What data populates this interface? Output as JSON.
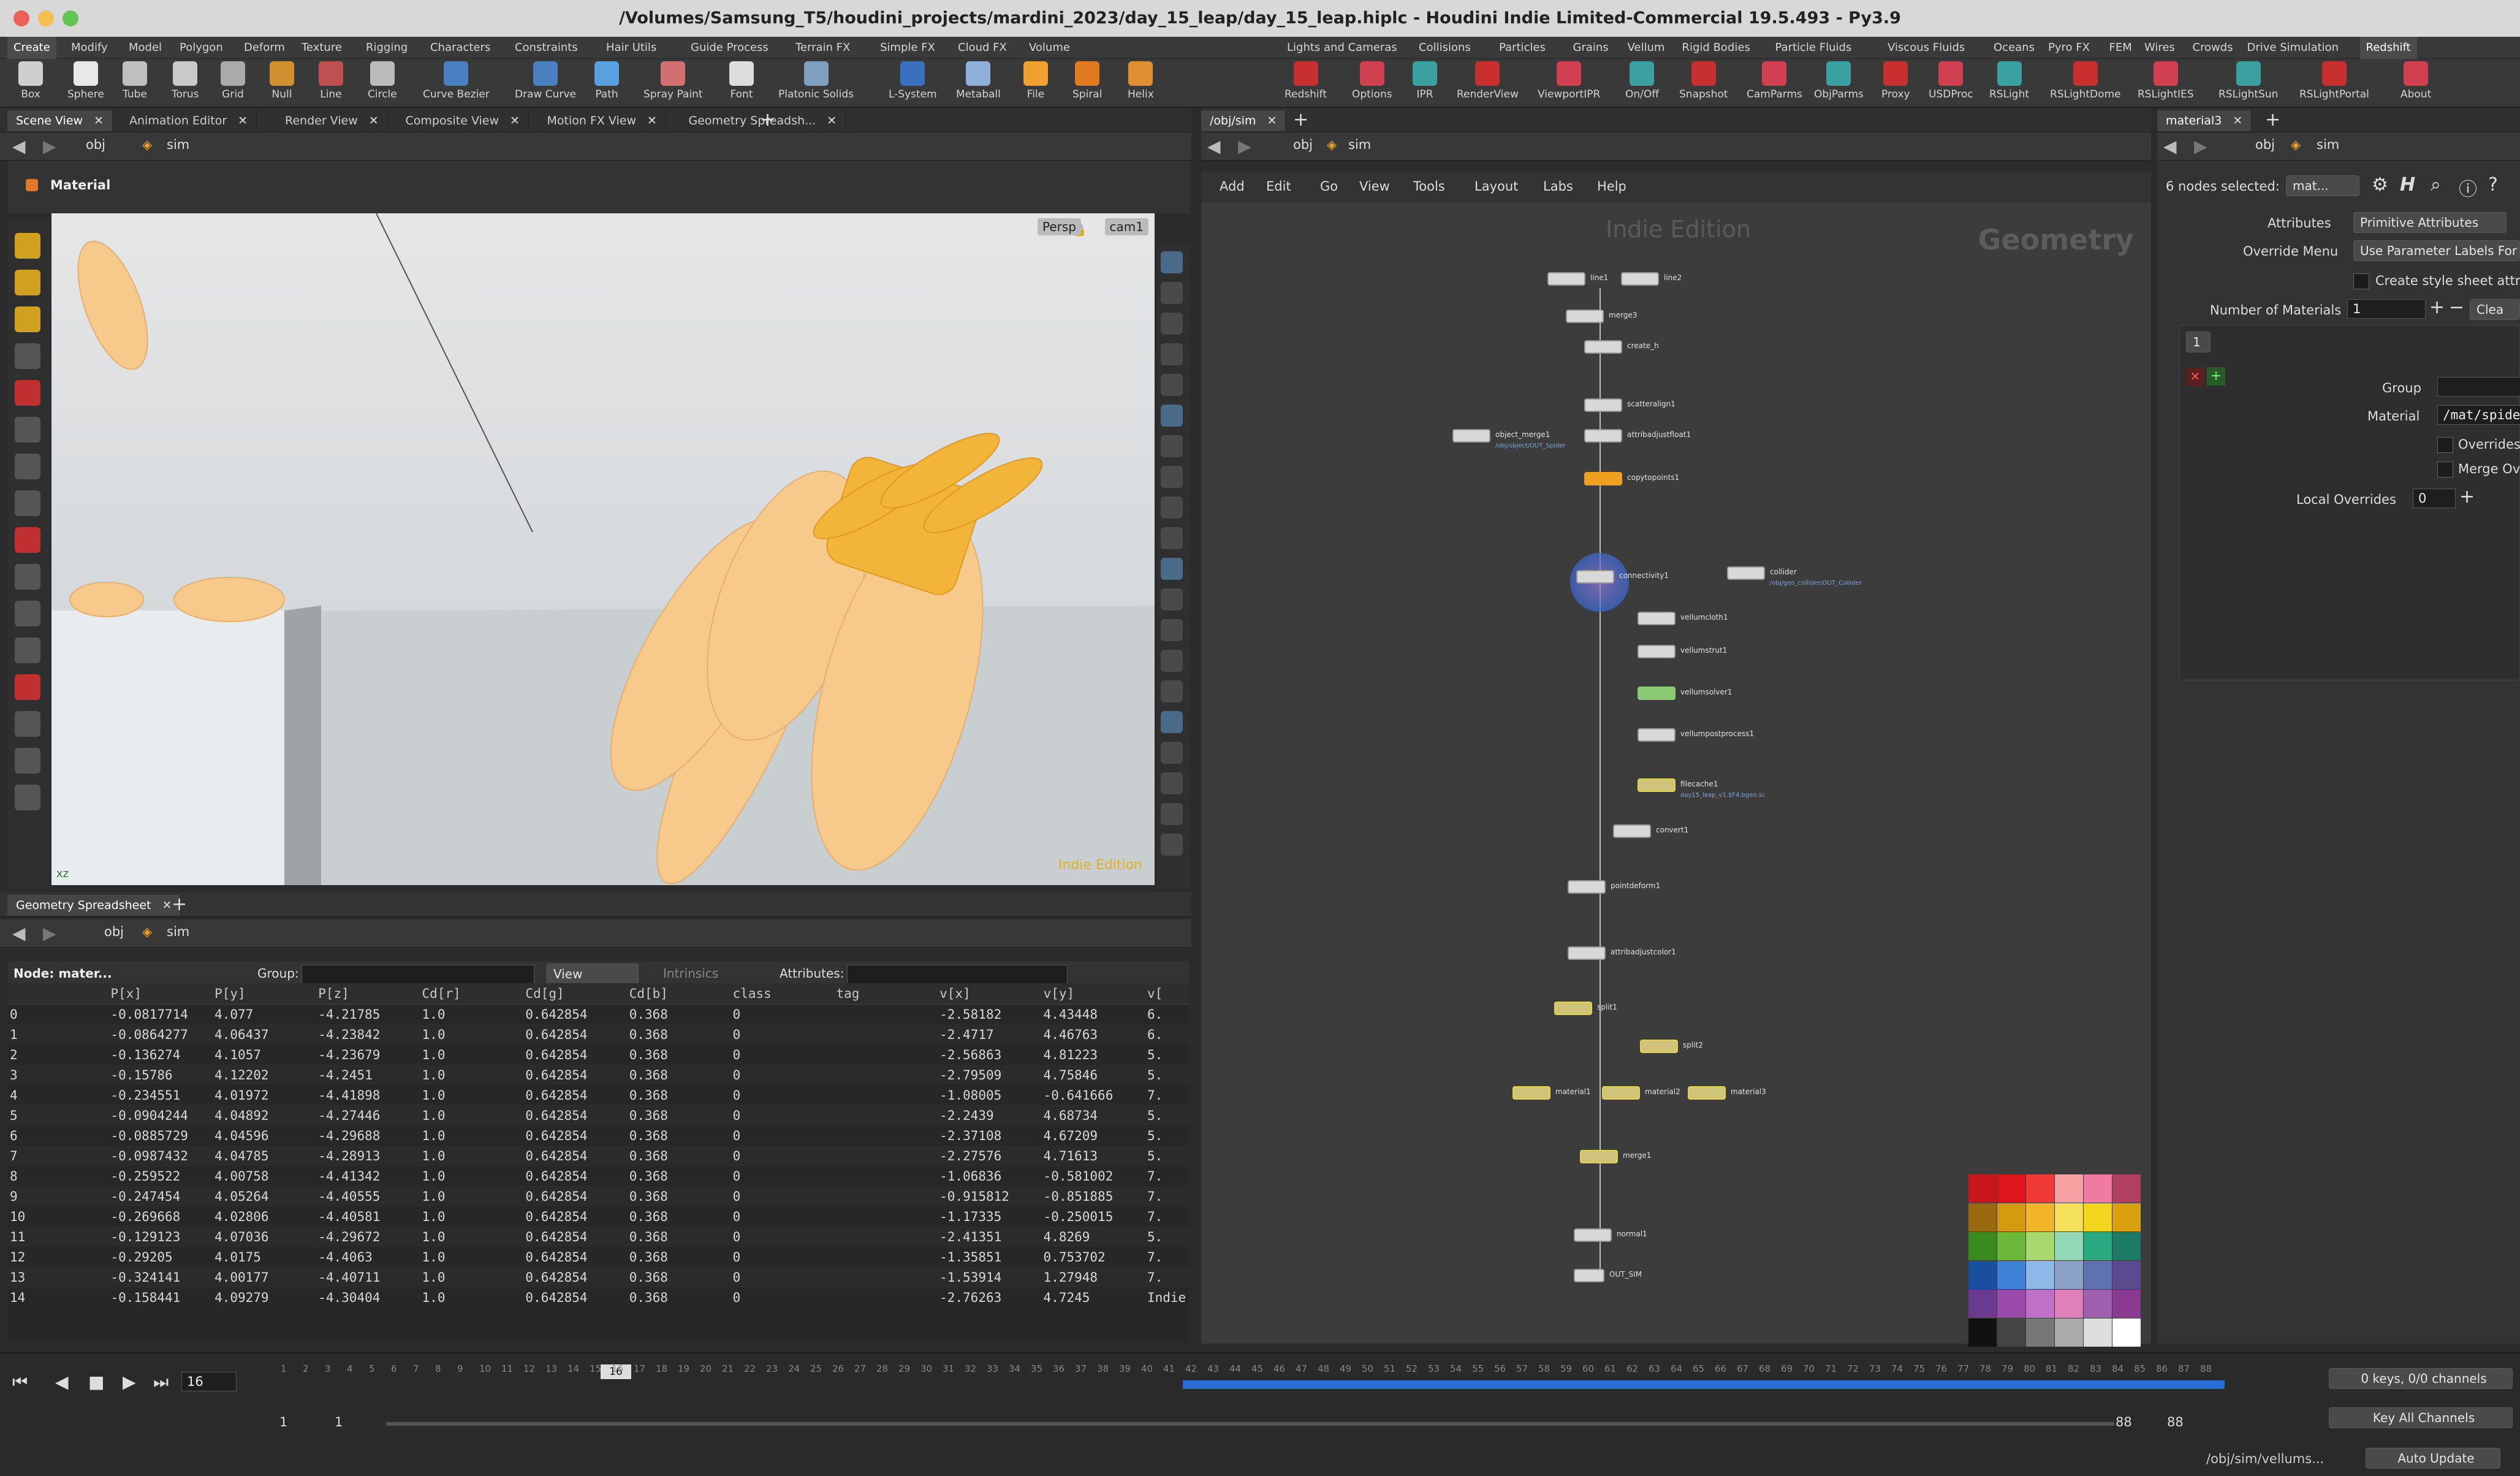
{
  "window": {
    "title": "/Volumes/Samsung_T5/houdini_projects/mardini_2023/day_15_leap/day_15_leap.hiplc - Houdini Indie Limited-Commercial 19.5.493 - Py3.9"
  },
  "menu_left": [
    "Create",
    "Modify",
    "Model",
    "Polygon",
    "Deform",
    "Texture",
    "Rigging",
    "Characters",
    "Constraints",
    "Hair Utils",
    "Guide Process",
    "Terrain FX",
    "Simple FX",
    "Cloud FX",
    "Volume"
  ],
  "menu_right": [
    "Lights and Cameras",
    "Collisions",
    "Particles",
    "Grains",
    "Vellum",
    "Rigid Bodies",
    "Particle Fluids",
    "Viscous Fluids",
    "Oceans",
    "Pyro FX",
    "FEM",
    "Wires",
    "Crowds",
    "Drive Simulation",
    "Redshift"
  ],
  "shelf_left": [
    "Box",
    "Sphere",
    "Tube",
    "Torus",
    "Grid",
    "Null",
    "Line",
    "Circle",
    "Curve Bezier",
    "Draw Curve",
    "Path",
    "Spray Paint",
    "Font",
    "Platonic Solids",
    "L-System",
    "Metaball",
    "File",
    "Spiral",
    "Helix"
  ],
  "shelf_right": [
    "Redshift",
    "Options",
    "IPR",
    "RenderView",
    "ViewportIPR",
    "On/Off",
    "Snapshot",
    "CamParms",
    "ObjParms",
    "Proxy",
    "USDProc",
    "RSLight",
    "RSLightDome",
    "RSLightIES",
    "RSLightSun",
    "RSLightPortal",
    "About"
  ],
  "left_tabs": [
    "Scene View",
    "Animation Editor",
    "Render View",
    "Composite View",
    "Motion FX View",
    "Geometry Spreadsh..."
  ],
  "path": {
    "obj": "obj",
    "sim": "sim",
    "network_tab": "/obj/sim",
    "param_tab": "material3"
  },
  "viewport": {
    "mode_label": "Material",
    "persp": "Persp",
    "cam": "cam1",
    "watermark": "Indie Edition",
    "axis": "xz"
  },
  "spreadsheet": {
    "tab": "Geometry Spreadsheet",
    "node_label": "Node: mater...",
    "group_label": "Group:",
    "view_label": "View",
    "intrinsics": "Intrinsics",
    "attributes_label": "Attributes:",
    "columns": [
      "",
      "P[x]",
      "P[y]",
      "P[z]",
      "Cd[r]",
      "Cd[g]",
      "Cd[b]",
      "class",
      "tag",
      "v[x]",
      "v[y]",
      "v["
    ],
    "rows": [
      [
        "0",
        "-0.0817714",
        "4.077",
        "-4.21785",
        "1.0",
        "0.642854",
        "0.368",
        "0",
        "",
        "-2.58182",
        "4.43448",
        "6."
      ],
      [
        "1",
        "-0.0864277",
        "4.06437",
        "-4.23842",
        "1.0",
        "0.642854",
        "0.368",
        "0",
        "",
        "-2.4717",
        "4.46763",
        "6."
      ],
      [
        "2",
        "-0.136274",
        "4.1057",
        "-4.23679",
        "1.0",
        "0.642854",
        "0.368",
        "0",
        "",
        "-2.56863",
        "4.81223",
        "5."
      ],
      [
        "3",
        "-0.15786",
        "4.12202",
        "-4.2451",
        "1.0",
        "0.642854",
        "0.368",
        "0",
        "",
        "-2.79509",
        "4.75846",
        "5."
      ],
      [
        "4",
        "-0.234551",
        "4.01972",
        "-4.41898",
        "1.0",
        "0.642854",
        "0.368",
        "0",
        "",
        "-1.08005",
        "-0.641666",
        "7."
      ],
      [
        "5",
        "-0.0904244",
        "4.04892",
        "-4.27446",
        "1.0",
        "0.642854",
        "0.368",
        "0",
        "",
        "-2.2439",
        "4.68734",
        "5."
      ],
      [
        "6",
        "-0.0885729",
        "4.04596",
        "-4.29688",
        "1.0",
        "0.642854",
        "0.368",
        "0",
        "",
        "-2.37108",
        "4.67209",
        "5."
      ],
      [
        "7",
        "-0.0987432",
        "4.04785",
        "-4.28913",
        "1.0",
        "0.642854",
        "0.368",
        "0",
        "",
        "-2.27576",
        "4.71613",
        "5."
      ],
      [
        "8",
        "-0.259522",
        "4.00758",
        "-4.41342",
        "1.0",
        "0.642854",
        "0.368",
        "0",
        "",
        "-1.06836",
        "-0.581002",
        "7."
      ],
      [
        "9",
        "-0.247454",
        "4.05264",
        "-4.40555",
        "1.0",
        "0.642854",
        "0.368",
        "0",
        "",
        "-0.915812",
        "-0.851885",
        "7."
      ],
      [
        "10",
        "-0.269668",
        "4.02806",
        "-4.40581",
        "1.0",
        "0.642854",
        "0.368",
        "0",
        "",
        "-1.17335",
        "-0.250015",
        "7."
      ],
      [
        "11",
        "-0.129123",
        "4.07036",
        "-4.29672",
        "1.0",
        "0.642854",
        "0.368",
        "0",
        "",
        "-2.41351",
        "4.8269",
        "5."
      ],
      [
        "12",
        "-0.29205",
        "4.0175",
        "-4.4063",
        "1.0",
        "0.642854",
        "0.368",
        "0",
        "",
        "-1.35851",
        "0.753702",
        "7."
      ],
      [
        "13",
        "-0.324141",
        "4.00177",
        "-4.40711",
        "1.0",
        "0.642854",
        "0.368",
        "0",
        "",
        "-1.53914",
        "1.27948",
        "7."
      ],
      [
        "14",
        "-0.158441",
        "4.09279",
        "-4.30404",
        "1.0",
        "0.642854",
        "0.368",
        "0",
        "",
        "-2.76263",
        "4.7245",
        "Indie"
      ]
    ]
  },
  "network": {
    "menu": [
      "Add",
      "Edit",
      "Go",
      "View",
      "Tools",
      "Layout",
      "Labs",
      "Help"
    ],
    "watermark": "Indie Edition",
    "context_label": "Geometry",
    "nodes": {
      "line1": "line1",
      "line2": "line2",
      "merge3": "merge3",
      "create_h": "create_h",
      "scatteralign1": "scatteralign1",
      "object_merge1": "object_merge1",
      "attribadjustfloat1": "attribadjustfloat1",
      "copytopoints1": "copytopoints1",
      "connectivity1": "connectivity1",
      "collider": "collider",
      "vellumcloth1": "vellumcloth1",
      "vellumstrut1": "vellumstrut1",
      "vellumsolver1": "vellumsolver1",
      "vellumpostprocess1": "vellumpostprocess1",
      "filecache1": "filecache1",
      "convert1": "convert1",
      "pointdeform1": "pointdeform1",
      "attribadjustcolor1": "attribadjustcolor1",
      "split1": "split1",
      "split2": "split2",
      "material1": "material1",
      "material2": "material2",
      "material3": "material3",
      "merge1": "merge1",
      "normal1": "normal1",
      "out_sim": "OUT_SIM"
    },
    "subs": {
      "object_merge1": "/obj/object/OUT_Spider",
      "collider": "/obj/geo_collider/OUT_Collider",
      "filecache1": "day15_leap_v1.$F4.bgeo.sc"
    }
  },
  "params": {
    "header": "6 nodes selected:",
    "header_field": "mat...",
    "attributes_label": "Attributes",
    "attributes_value": "Primitive Attributes",
    "override_label": "Override Menu",
    "override_value": "Use Parameter Labels For",
    "create_style": "Create style sheet attrib",
    "num_materials_label": "Number of Materials",
    "num_materials_value": "1",
    "clear": "Clea",
    "instance_tab": "1",
    "group_label": "Group",
    "group_value": "",
    "material_label": "Material",
    "material_value": "/mat/spider",
    "overrides_label": "Overrides u",
    "merge_over": "Merge Over",
    "local_overrides_label": "Local Overrides",
    "local_overrides_value": "0"
  },
  "timeline": {
    "frame": "16",
    "start": "1",
    "start2": "1",
    "end": "88",
    "end2": "88",
    "keys": "0 keys, 0/0 channels",
    "key_all": "Key All Channels",
    "status_path": "/obj/sim/vellums...",
    "auto_update": "Auto Update",
    "ticks": [
      "1",
      "2",
      "3",
      "4",
      "5",
      "6",
      "7",
      "8",
      "9",
      "10",
      "11",
      "12",
      "13",
      "14",
      "15",
      "16",
      "17",
      "18",
      "19",
      "20",
      "21",
      "22",
      "23",
      "24",
      "25",
      "26",
      "27",
      "28",
      "29",
      "30",
      "31",
      "32",
      "33",
      "34",
      "35",
      "36",
      "37",
      "38",
      "39",
      "40",
      "41",
      "42",
      "43",
      "44",
      "45",
      "46",
      "47",
      "48",
      "49",
      "50",
      "51",
      "52",
      "53",
      "54",
      "55",
      "56",
      "57",
      "58",
      "59",
      "60",
      "61",
      "62",
      "63",
      "64",
      "65",
      "66",
      "67",
      "68",
      "69",
      "70",
      "71",
      "72",
      "73",
      "74",
      "75",
      "76",
      "77",
      "78",
      "79",
      "80",
      "81",
      "82",
      "83",
      "84",
      "85",
      "86",
      "87",
      "88"
    ],
    "cached_from": "42"
  },
  "colors": {
    "accent_orange": "#f0a020",
    "node_yellow": "#e3d34a",
    "cache_blue": "#2a6fd6",
    "palette": [
      "#c8161c",
      "#e0141b",
      "#f03a36",
      "#f7a3a3",
      "#f07aa0",
      "#b04060",
      "#9a6a10",
      "#d49a10",
      "#f2b428",
      "#f5e05a",
      "#f2d51c",
      "#d9a010",
      "#3a8a20",
      "#6bb83a",
      "#a9d870",
      "#93d8b8",
      "#2aa880",
      "#1c7a66",
      "#1a4fa0",
      "#3d80d6",
      "#8fb8ea",
      "#8aa2c8",
      "#5e72b0",
      "#5a4a90",
      "#6a3a90",
      "#9a4aa8",
      "#c070c8",
      "#e080b8",
      "#a060b0",
      "#8a3a90",
      "#111111",
      "#444444",
      "#777777",
      "#aaaaaa",
      "#dddddd",
      "#ffffff"
    ]
  }
}
